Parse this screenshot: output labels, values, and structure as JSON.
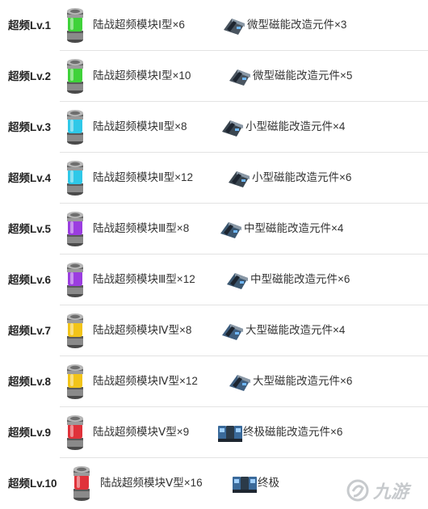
{
  "rows": [
    {
      "level": "超频Lv.1",
      "module": "陆战超频模块Ⅰ型×6",
      "part": "微型磁能改造元件×3",
      "color": "#3fd23a",
      "part_color": "#4a5560"
    },
    {
      "level": "超频Lv.2",
      "module": "陆战超频模块Ⅰ型×10",
      "part": "微型磁能改造元件×5",
      "color": "#3fd23a",
      "part_color": "#4a5560"
    },
    {
      "level": "超频Lv.3",
      "module": "陆战超频模块Ⅱ型×8",
      "part": "小型磁能改造元件×4",
      "color": "#2fc8e8",
      "part_color": "#3a4650"
    },
    {
      "level": "超频Lv.4",
      "module": "陆战超频模块Ⅱ型×12",
      "part": "小型磁能改造元件×6",
      "color": "#2fc8e8",
      "part_color": "#3a4650"
    },
    {
      "level": "超频Lv.5",
      "module": "陆战超频模块Ⅲ型×8",
      "part": "中型磁能改造元件×4",
      "color": "#9b3de0",
      "part_color": "#3b5770"
    },
    {
      "level": "超频Lv.6",
      "module": "陆战超频模块Ⅲ型×12",
      "part": "中型磁能改造元件×6",
      "color": "#9b3de0",
      "part_color": "#3b5770"
    },
    {
      "level": "超频Lv.7",
      "module": "陆战超频模块Ⅳ型×8",
      "part": "大型磁能改造元件×4",
      "color": "#f2c419",
      "part_color": "#3f5f80"
    },
    {
      "level": "超频Lv.8",
      "module": "陆战超频模块Ⅳ型×12",
      "part": "大型磁能改造元件×6",
      "color": "#f2c419",
      "part_color": "#3f5f80"
    },
    {
      "level": "超频Lv.9",
      "module": "陆战超频模块Ⅴ型×9",
      "part": "终极磁能改造元件×6",
      "color": "#e0323a",
      "part_color": "#3a6a9a"
    },
    {
      "level": "超频Lv.10",
      "module": "陆战超频模块Ⅴ型×16",
      "part": "终极",
      "color": "#e0323a",
      "part_color": "#3a6a9a"
    }
  ],
  "watermark": {
    "text": "九游",
    "icon": "jiuyou-logo-icon"
  }
}
